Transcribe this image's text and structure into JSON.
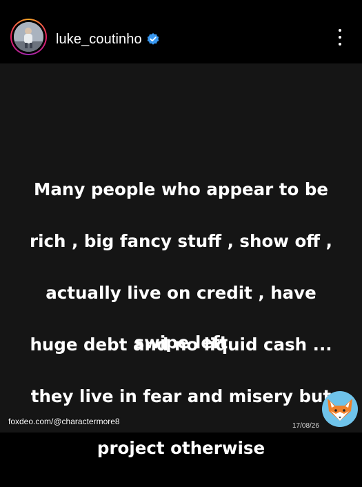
{
  "header": {
    "username": "luke_coutinho",
    "verified": true,
    "avatar_icon": "profile-photo",
    "more_icon": "more-vertical-icon"
  },
  "post": {
    "lines": [
      "Many people who appear to be",
      "rich , big fancy stuff , show off ,",
      "actually live  on credit , have",
      "huge debt and no liquid cash ...",
      "they live in fear and misery but",
      "project otherwise"
    ],
    "swipe": "swipe left",
    "background_color": "#151515",
    "text_color": "#ffffff"
  },
  "overlay": {
    "watermark": "foxdeo.com/@charactermore8",
    "date": "17/08/26",
    "logo_icon": "fox-logo-icon"
  },
  "colors": {
    "verified_badge": "#3897f0",
    "ring_start": "#f9a825",
    "ring_end": "#e91e63"
  }
}
